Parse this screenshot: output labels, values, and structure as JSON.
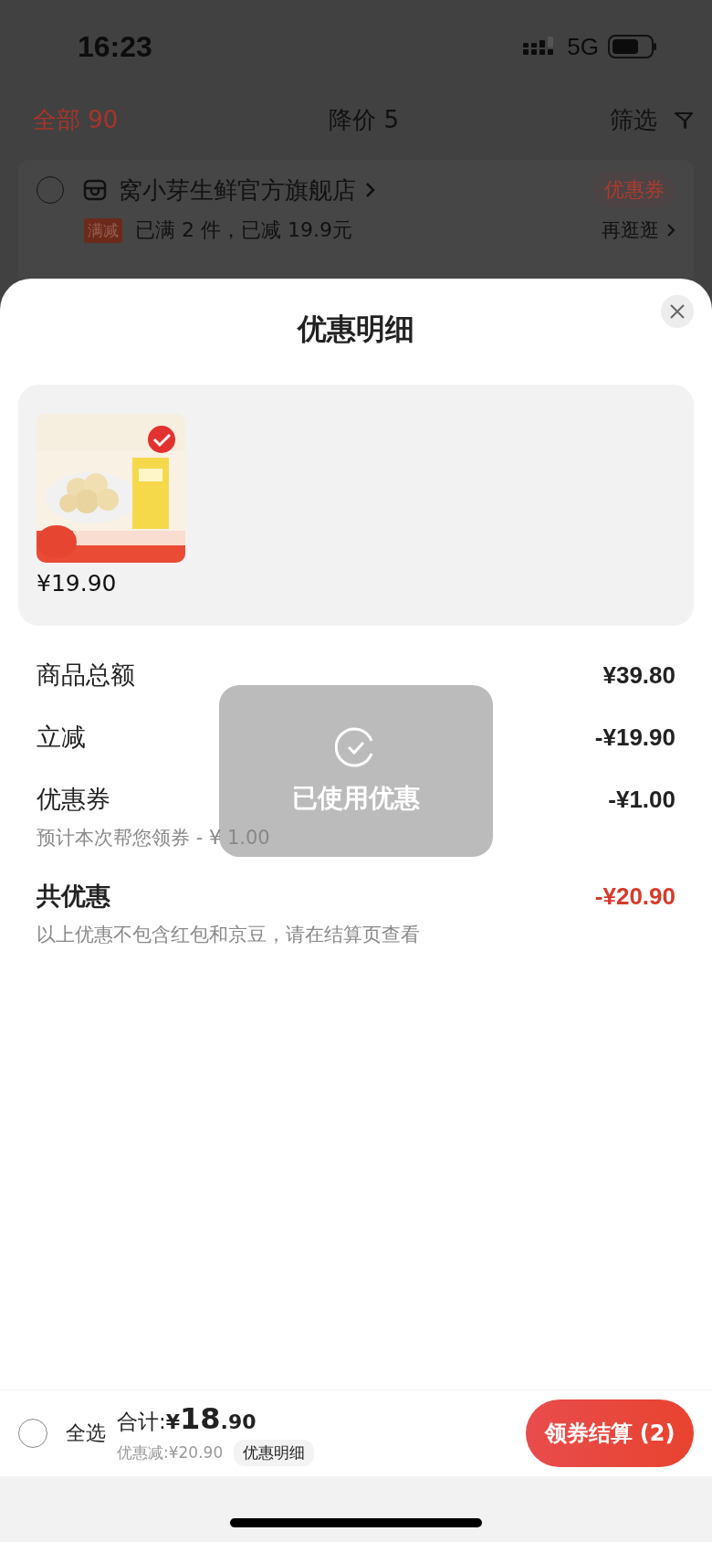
{
  "status_bar": {
    "time": "16:23",
    "network": "5G"
  },
  "background_page": {
    "tabs": [
      {
        "label": "全部 90",
        "selected": true
      },
      {
        "label": "降价 5",
        "selected": false
      }
    ],
    "filter": {
      "label": "筛选"
    },
    "store": {
      "name": "窝小芽生鲜官方旗舰店",
      "checked": false,
      "coupon_badge": "优惠券",
      "promo_tag": "满减",
      "promo_text": "已满 2 件，已减 19.9元",
      "more_link": "再逛逛"
    }
  },
  "sheet": {
    "title": "优惠明细",
    "products": [
      {
        "kind": "picture",
        "checked": true,
        "price": "¥19.90"
      }
    ],
    "rows": [
      {
        "kind": "plain",
        "label": "商品总额",
        "value": "¥39.80"
      },
      {
        "kind": "plain",
        "label": "立减",
        "value": "-¥19.90"
      },
      {
        "kind": "plain",
        "label": "优惠券",
        "value": "-¥1.00",
        "note": "预计本次帮您领券 - ¥ 1.00"
      },
      {
        "kind": "total",
        "label": "共优惠",
        "value": "-¥20.90",
        "note": "以上优惠不包含红包和京豆，请在结算页查看"
      }
    ],
    "toast": {
      "text": "已使用优惠"
    }
  },
  "bottom_bar": {
    "select_all": {
      "label": "全选",
      "checked": false
    },
    "total_label": "合计:",
    "total_currency": "¥",
    "total_int": "18",
    "total_dec": ".90",
    "discount": "优惠减:¥20.90",
    "detail_button": "优惠明细",
    "checkout_button": "领券结算 (2)"
  }
}
